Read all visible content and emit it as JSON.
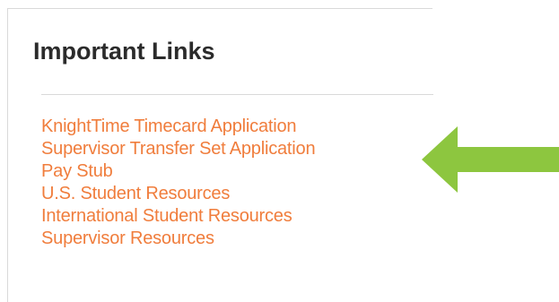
{
  "panel": {
    "title": "Important Links",
    "links": [
      {
        "label": "KnightTime Timecard Application"
      },
      {
        "label": "Supervisor Transfer Set Application"
      },
      {
        "label": "Pay Stub"
      },
      {
        "label": "U.S. Student Resources"
      },
      {
        "label": "International Student Resources"
      },
      {
        "label": "Supervisor Resources"
      }
    ],
    "link_color": "#f07d3c",
    "title_color": "#2b2b2b"
  },
  "annotation": {
    "icon": "left-arrow-icon",
    "color": "#8dc63f"
  }
}
